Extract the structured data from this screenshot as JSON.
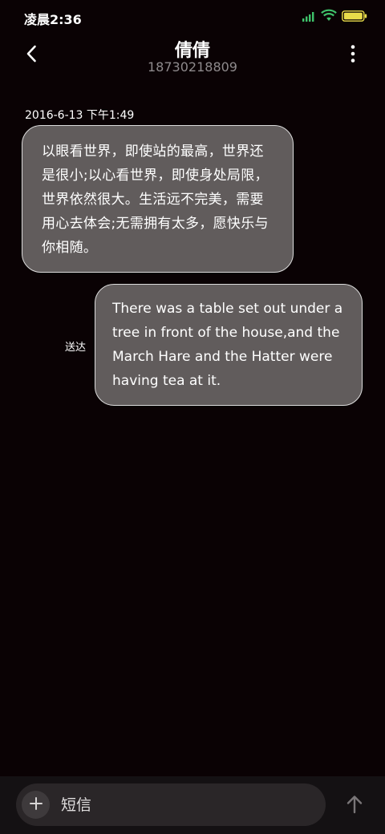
{
  "status_bar": {
    "time": "凌晨2:36",
    "icons": [
      "signal-icon",
      "wifi-icon",
      "battery-icon"
    ]
  },
  "header": {
    "contact_name": "倩倩",
    "contact_number": "18730218809"
  },
  "conversation": {
    "timestamp": "2016-6-13 下午1:49",
    "messages": [
      {
        "direction": "incoming",
        "text": "以眼看世界，即使站的最高，世界还是很小;以心看世界，即使身处局限，世界依然很大。生活远不完美，需要用心去体会;无需拥有太多，愿快乐与你相随。"
      },
      {
        "direction": "outgoing",
        "text": "There was a table set out under a tree in front of the house,and the March Hare and the Hatter were having tea at it.",
        "status": "送达"
      }
    ]
  },
  "compose": {
    "placeholder": "短信",
    "value": ""
  },
  "colors": {
    "background": "#0a0204",
    "bubble_fill": "#615c5c",
    "bubble_border": "#dcdcdc",
    "number_text": "#8e8a8c",
    "battery_fill": "#e8dc4a",
    "signal_wifi": "#3fc36b"
  }
}
